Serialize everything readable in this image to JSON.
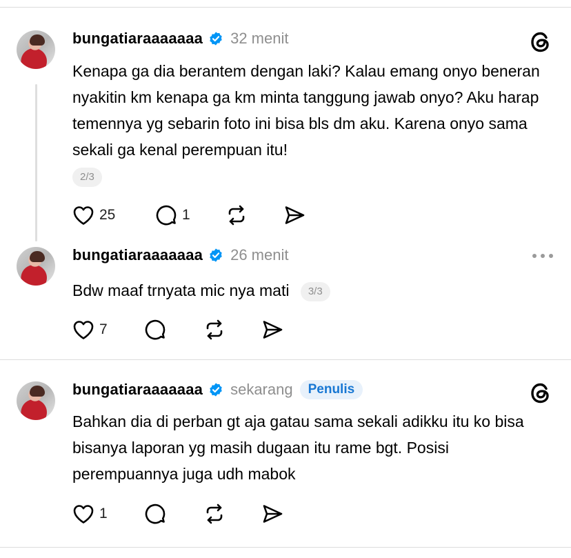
{
  "posts": [
    {
      "username": "bungatiaraaaaaaa",
      "time": "32 menit",
      "text": "Kenapa ga dia berantem dengan laki? Kalau emang onyo beneran nyakitin km kenapa ga km minta tanggung jawab onyo? Aku harap temennya yg sebarin foto ini bisa bls dm aku. Karena onyo sama sekali ga kenal perempuan itu!",
      "pager": "2/3",
      "likes": "25",
      "replies": "1",
      "corner_icon": "threads-logo-icon"
    },
    {
      "username": "bungatiaraaaaaaa",
      "time": "26 menit",
      "text": "Bdw maaf trnyata mic nya mati",
      "pager": "3/3",
      "likes": "7",
      "replies": "",
      "corner_icon": "more-options-icon"
    },
    {
      "username": "bungatiaraaaaaaa",
      "time": "sekarang",
      "badge": "Penulis",
      "text": "Bahkan dia di perban gt aja gatau sama sekali adikku itu ko bisa bisanya laporan yg masih dugaan itu rame bgt. Posisi perempuannya juga udh mabok",
      "likes": "1",
      "replies": "",
      "corner_icon": "threads-logo-icon"
    }
  ],
  "colors": {
    "verified": "#0095f6",
    "badge_text": "#1877d3",
    "badge_bg": "#e8f1fb",
    "muted": "#8e8e8e"
  }
}
